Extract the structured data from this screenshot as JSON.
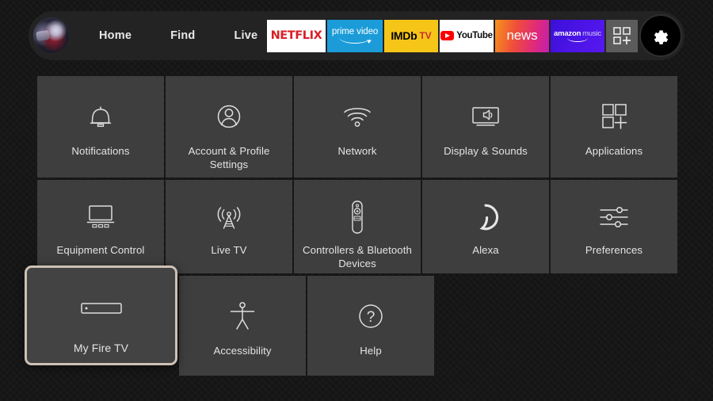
{
  "navbar": {
    "avatar": {
      "name": "profile-avatar"
    },
    "links": [
      {
        "label": "Home",
        "name": "nav-link-home"
      },
      {
        "label": "Find",
        "name": "nav-link-find"
      },
      {
        "label": "Live",
        "name": "nav-link-live"
      }
    ],
    "app_tiles": [
      {
        "name": "netflix",
        "label": "NETFLIX",
        "bg": "#ffffff"
      },
      {
        "name": "prime-video",
        "label": "prime video",
        "bg": "#1b9cd8"
      },
      {
        "name": "imdb-tv",
        "label": "IMDb",
        "label2": "TV",
        "bg": "#f5c518"
      },
      {
        "name": "youtube",
        "label": "YouTube",
        "bg": "#ffffff"
      },
      {
        "name": "news",
        "label": "news",
        "bg": "#e02a7a"
      },
      {
        "name": "amazon-music",
        "label": "amazon",
        "label2": "music",
        "bg": "#4b14e6"
      },
      {
        "name": "appstore",
        "label": "",
        "bg": "#5c5c5c"
      }
    ],
    "settings_button": {
      "icon": "gear-icon"
    }
  },
  "grid": {
    "selected_tile": "My Fire TV",
    "selection_border_color": "#cdc0b4",
    "tile_bg_color": "#3e3e3e",
    "rows": [
      [
        {
          "label": "Notifications",
          "icon": "bell-icon"
        },
        {
          "label": "Account & Profile Settings",
          "icon": "person-icon"
        },
        {
          "label": "Network",
          "icon": "wifi-icon"
        },
        {
          "label": "Display & Sounds",
          "icon": "display-sound-icon"
        },
        {
          "label": "Applications",
          "icon": "apps-grid-icon"
        }
      ],
      [
        {
          "label": "Equipment Control",
          "icon": "tv-equipment-icon"
        },
        {
          "label": "Live TV",
          "icon": "broadcast-tower-icon"
        },
        {
          "label": "Controllers & Bluetooth Devices",
          "icon": "remote-control-icon"
        },
        {
          "label": "Alexa",
          "icon": "alexa-ring-icon"
        },
        {
          "label": "Preferences",
          "icon": "sliders-icon"
        }
      ],
      [
        {
          "label": "My Fire TV",
          "icon": "fire-tv-stick-icon",
          "selected": true
        },
        {
          "label": "Accessibility",
          "icon": "accessibility-icon"
        },
        {
          "label": "Help",
          "icon": "question-circle-icon"
        }
      ]
    ]
  }
}
